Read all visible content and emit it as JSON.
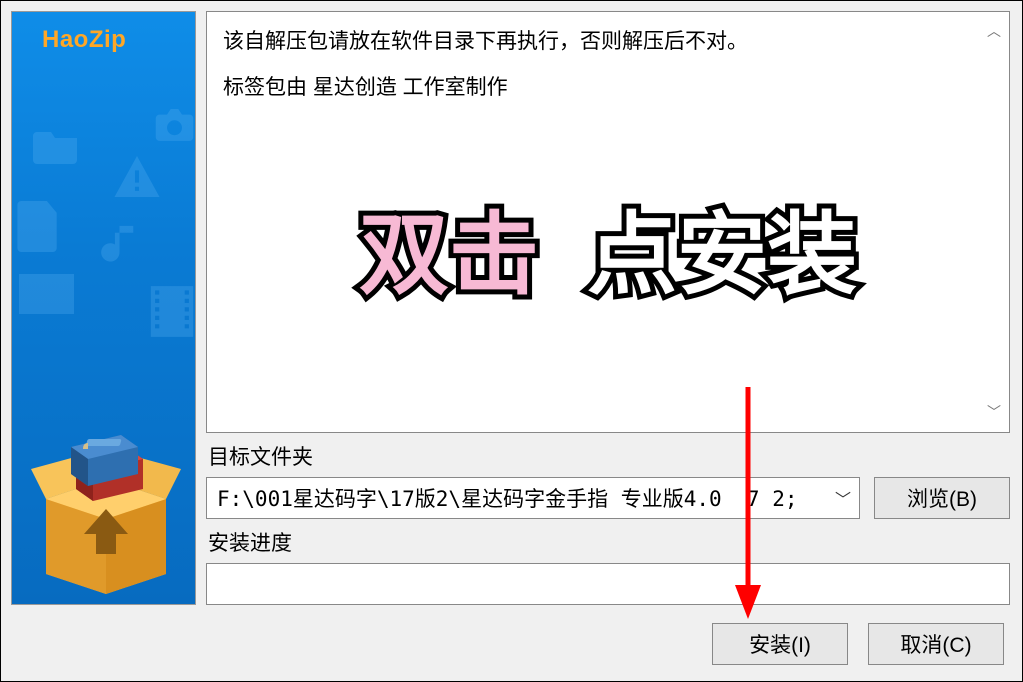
{
  "sidebar": {
    "brand": "HaoZip"
  },
  "description": {
    "line1": "该自解压包请放在软件目录下再执行，否则解压后不对。",
    "line2": "标签包由 星达创造 工作室制作"
  },
  "overlay": {
    "left": "双击",
    "right": "点安装"
  },
  "target": {
    "label": "目标文件夹",
    "path": "F:\\001星达码字\\17版2\\星达码字金手指 专业版4.0  7 2;"
  },
  "browse_button": "浏览(B)",
  "progress": {
    "label": "安装进度"
  },
  "buttons": {
    "install": "安装(I)",
    "cancel": "取消(C)"
  }
}
